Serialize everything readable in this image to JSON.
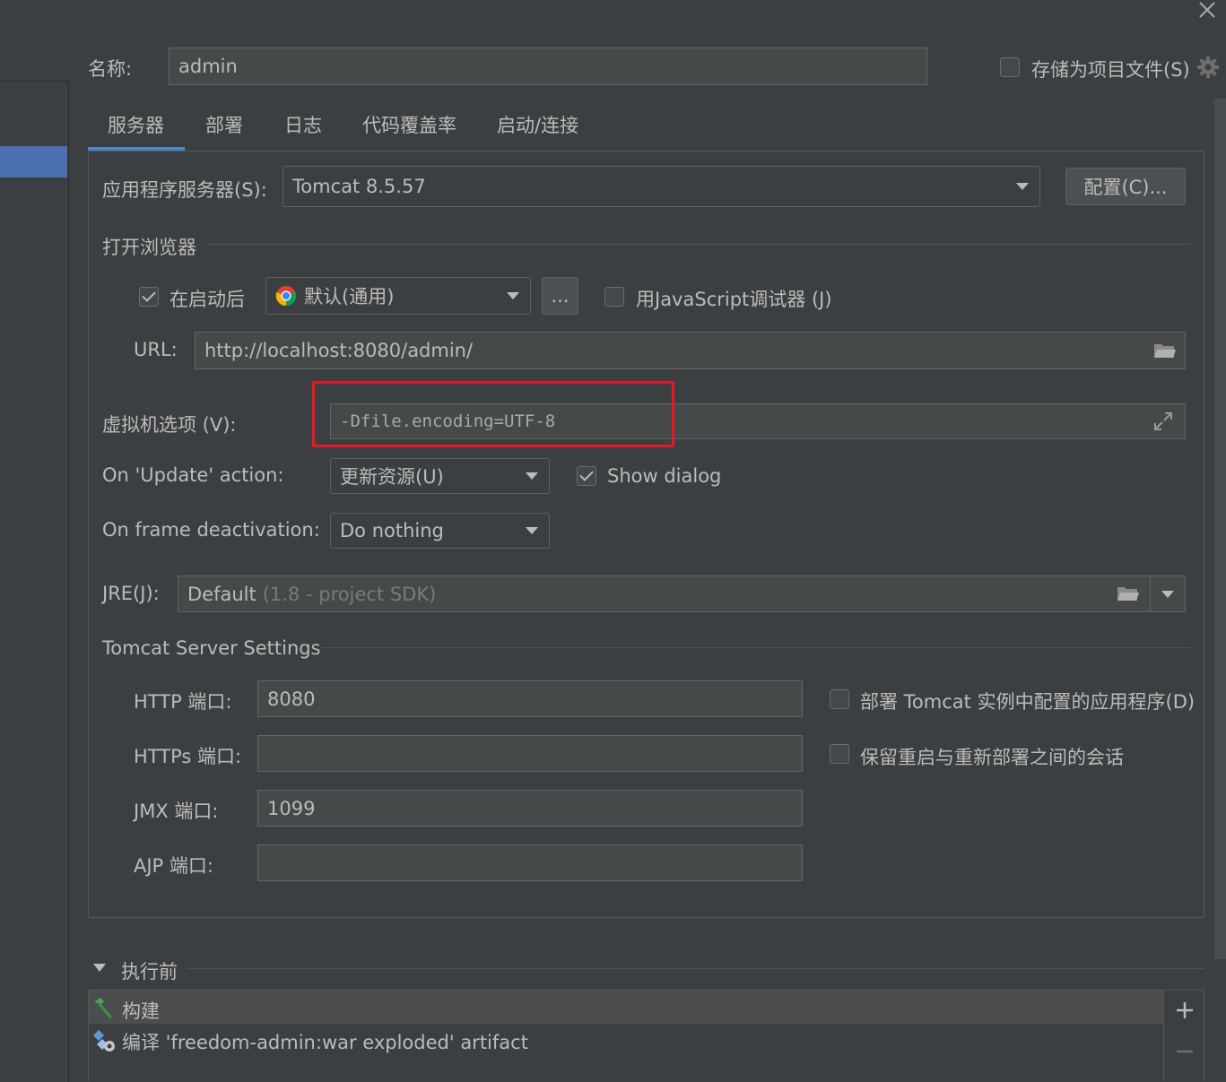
{
  "name_label": "名称:",
  "name_value": "admin",
  "store_as_project_file": "存储为项目文件(S)",
  "tabs": [
    "服务器",
    "部署",
    "日志",
    "代码覆盖率",
    "启动/连接"
  ],
  "app_server_label": "应用程序服务器(S):",
  "app_server_value": "Tomcat 8.5.57",
  "configure_button": "配置(C)...",
  "open_browser_title": "打开浏览器",
  "after_launch_label": "在启动后",
  "after_launch_checked": true,
  "browser_value": "默认(通用)",
  "browse_button": "...",
  "js_debugger_label": "用JavaScript调试器 (J)",
  "js_debugger_checked": false,
  "url_label": "URL:",
  "url_value": "http://localhost:8080/admin/",
  "vm_options_label": "虚拟机选项 (V):",
  "vm_options_value": "-Dfile.encoding=UTF-8",
  "on_update_label": "On 'Update' action:",
  "on_update_value": "更新资源(U)",
  "show_dialog_label": "Show dialog",
  "show_dialog_checked": true,
  "on_frame_label": "On frame deactivation:",
  "on_frame_value": "Do nothing",
  "jre_label": "JRE(J):",
  "jre_value": "Default",
  "jre_hint": "(1.8 - project SDK)",
  "tomcat_settings_title": "Tomcat Server Settings",
  "http_port_label": "HTTP 端口:",
  "http_port_value": "8080",
  "https_port_label": "HTTPs 端口:",
  "https_port_value": "",
  "jmx_port_label": "JMX 端口:",
  "jmx_port_value": "1099",
  "ajp_port_label": "AJP 端口:",
  "ajp_port_value": "",
  "deploy_apps_label": "部署 Tomcat 实例中配置的应用程序(D)",
  "deploy_apps_checked": false,
  "preserve_sessions_label": "保留重启与重新部署之间的会话",
  "preserve_sessions_checked": false,
  "before_launch_title": "执行前",
  "before_launch_items": [
    "构建",
    "编译 'freedom-admin:war exploded' artifact"
  ],
  "colors": {
    "background": "#3c3f41",
    "field": "#45494a",
    "accent": "#4a88c7",
    "highlight_box": "#e8191e"
  }
}
